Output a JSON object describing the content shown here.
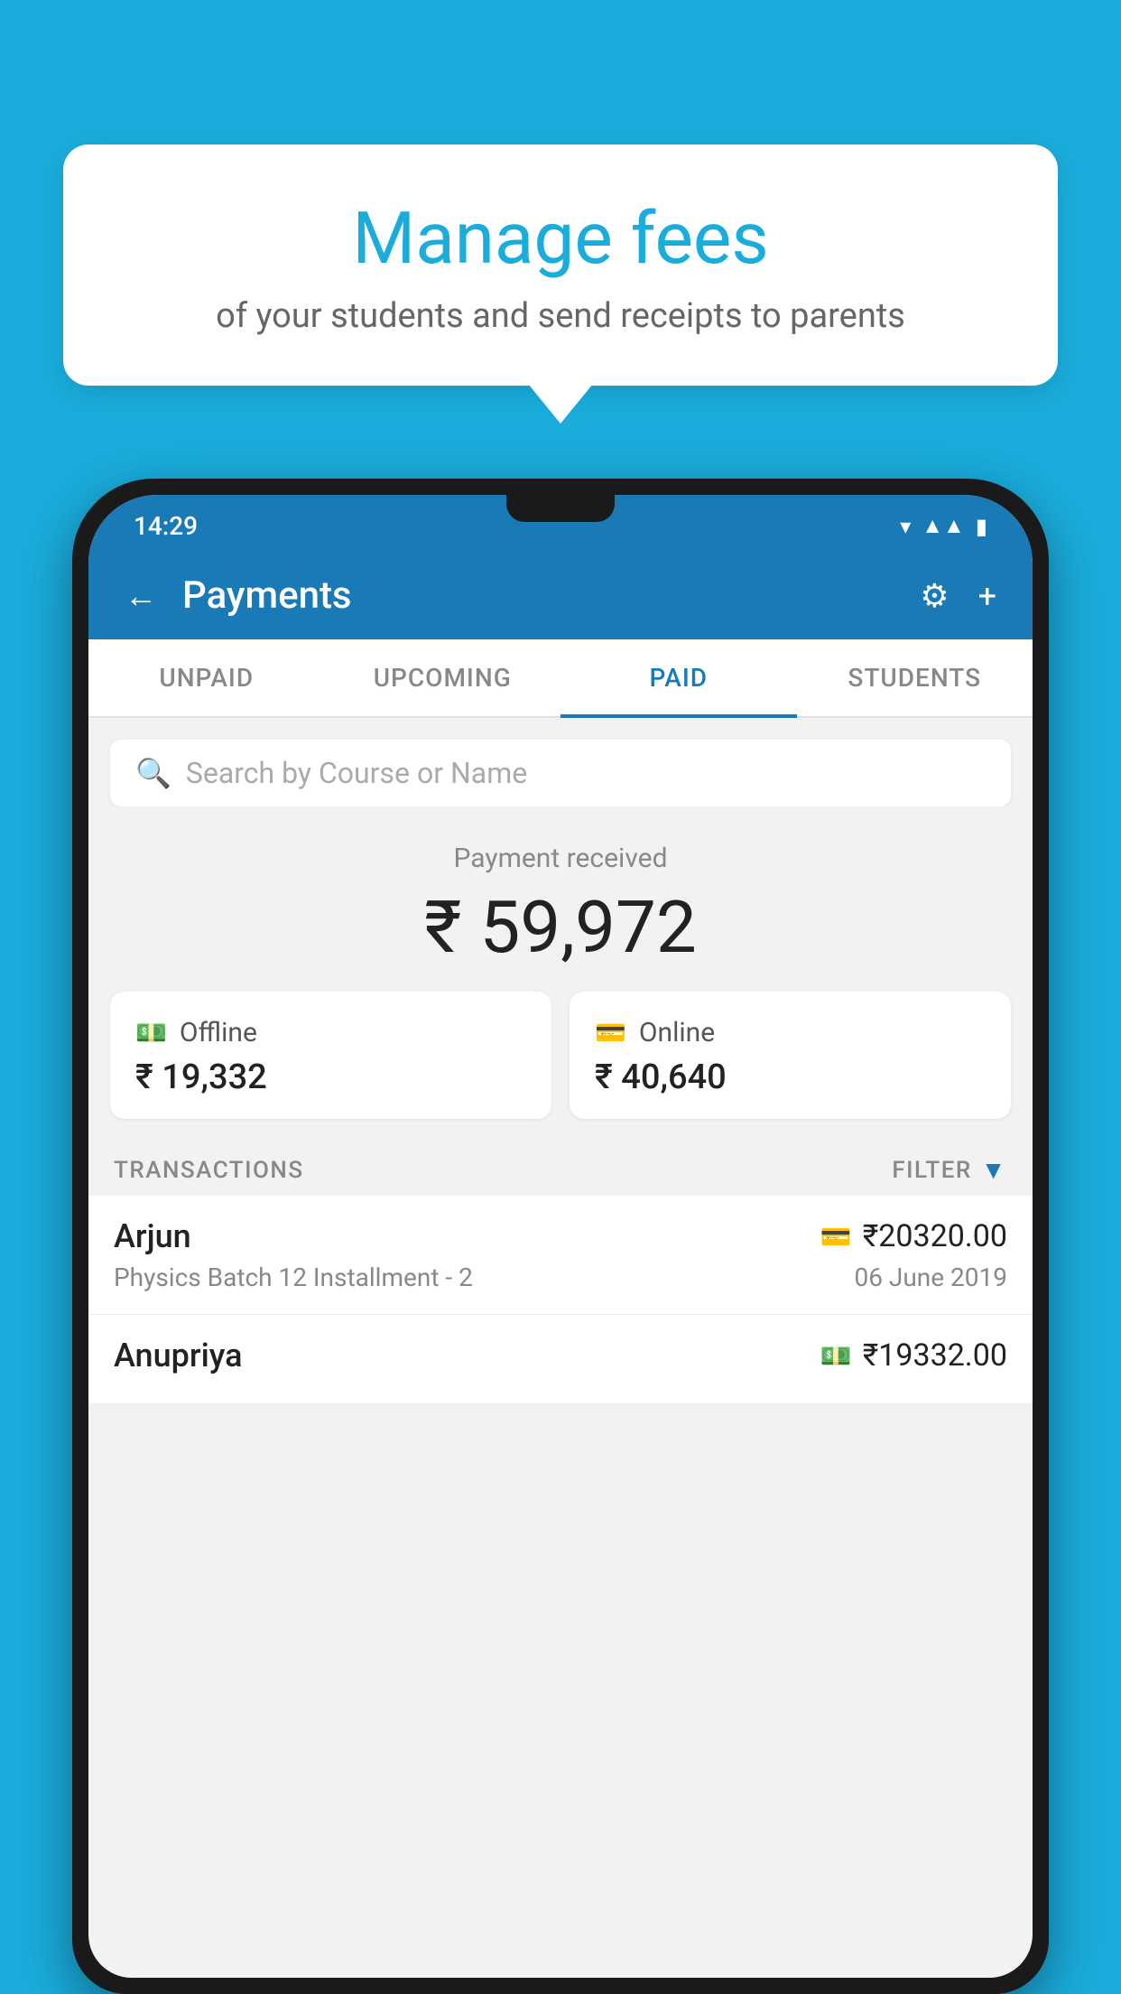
{
  "background_color": "#1aaddc",
  "tooltip": {
    "title": "Manage fees",
    "subtitle": "of your students and send receipts to parents"
  },
  "status_bar": {
    "time": "14:29",
    "icons": [
      "wifi",
      "signal",
      "battery"
    ]
  },
  "header": {
    "title": "Payments",
    "back_label": "←",
    "settings_icon": "⚙",
    "add_icon": "+"
  },
  "tabs": [
    {
      "label": "UNPAID",
      "active": false
    },
    {
      "label": "UPCOMING",
      "active": false
    },
    {
      "label": "PAID",
      "active": true
    },
    {
      "label": "STUDENTS",
      "active": false
    }
  ],
  "search": {
    "placeholder": "Search by Course or Name"
  },
  "payment": {
    "label": "Payment received",
    "amount": "₹ 59,972",
    "offline_label": "Offline",
    "offline_amount": "₹ 19,332",
    "online_label": "Online",
    "online_amount": "₹ 40,640"
  },
  "transactions": {
    "header_label": "TRANSACTIONS",
    "filter_label": "FILTER",
    "rows": [
      {
        "name": "Arjun",
        "description": "Physics Batch 12 Installment - 2",
        "amount": "₹20320.00",
        "date": "06 June 2019",
        "payment_type": "online"
      },
      {
        "name": "Anupriya",
        "description": "",
        "amount": "₹19332.00",
        "date": "",
        "payment_type": "offline"
      }
    ]
  }
}
